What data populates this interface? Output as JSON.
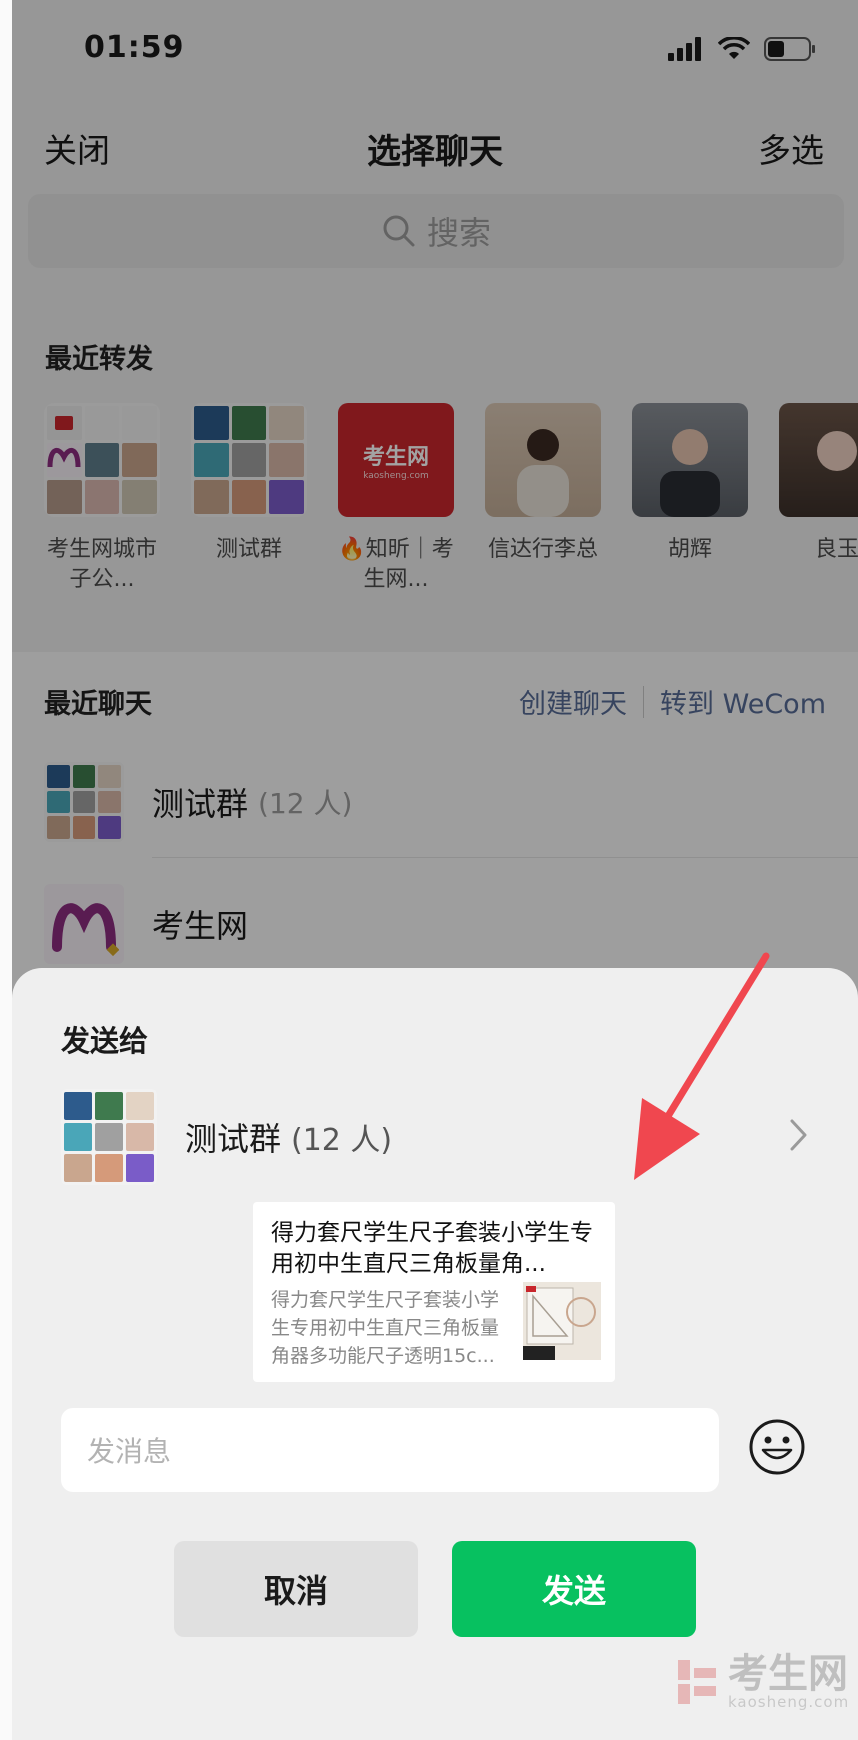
{
  "status_bar": {
    "time": "01:59"
  },
  "nav": {
    "close": "关闭",
    "title": "选择聊天",
    "multi_select": "多选"
  },
  "search": {
    "placeholder": "搜索"
  },
  "recent_forward": {
    "label": "最近转发",
    "contacts": [
      {
        "name": "考生网城市子公..."
      },
      {
        "name": "测试群"
      },
      {
        "name": "🔥知昕｜考生网..."
      },
      {
        "name": "信达行李总"
      },
      {
        "name": "胡辉"
      },
      {
        "name": "良玉"
      }
    ]
  },
  "recent_chats": {
    "label": "最近聊天",
    "create_chat": "创建聊天",
    "to_wecom": "转到 WeCom",
    "items": [
      {
        "name": "测试群",
        "count": "(12 人)"
      },
      {
        "name": "考生网",
        "count": ""
      }
    ]
  },
  "sheet": {
    "title": "发送给",
    "target_name": "测试群",
    "target_count": "(12 人)",
    "card_title": "得力套尺学生尺子套装小学生专用初中生直尺三角板量角...",
    "card_desc": "得力套尺学生尺子套装小学生专用初中生直尺三角板量角器多功能尺子透明15c...",
    "message_placeholder": "发消息",
    "cancel": "取消",
    "send": "发送"
  },
  "logo_texts": {
    "kaosheng_tile": "考生网",
    "kaosheng_tile_sub": "kaosheng.com"
  },
  "watermark": {
    "brand": "考生网",
    "url": "kaosheng.com"
  },
  "colors": {
    "send_green": "#07c160",
    "link_blue": "#576b95",
    "arrow_red": "#f0474f"
  }
}
